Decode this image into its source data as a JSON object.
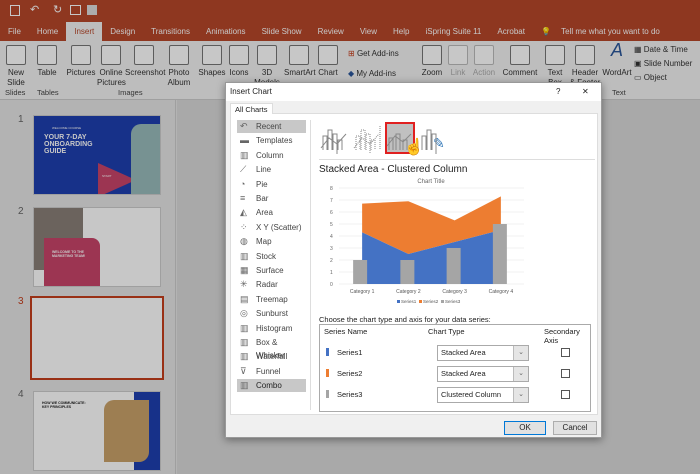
{
  "qat": {
    "icons": [
      "save-icon",
      "undo-icon",
      "redo-icon",
      "present-icon",
      "customize-icon"
    ]
  },
  "tabs": [
    "File",
    "Home",
    "Insert",
    "Design",
    "Transitions",
    "Animations",
    "Slide Show",
    "Review",
    "View",
    "Help",
    "iSpring Suite 11",
    "Acrobat"
  ],
  "active_tab": "Insert",
  "tell_me": "Tell me what you want to do",
  "ribbon": {
    "new_slide": "New Slide",
    "table": "Table",
    "pictures": "Pictures",
    "online_pictures": "Online Pictures",
    "screenshot": "Screenshot",
    "photo_album": "Photo Album",
    "shapes": "Shapes",
    "icons": "Icons",
    "3d": "3D Models",
    "smartart": "SmartArt",
    "chart": "Chart",
    "get_addins": "Get Add-ins",
    "my_addins": "My Add-ins",
    "zoom": "Zoom",
    "link": "Link",
    "action": "Action",
    "comment": "Comment",
    "text_box": "Text Box",
    "header_footer": "Header & Footer",
    "wordart": "WordArt",
    "date_time": "Date & Time",
    "slide_number": "Slide Number",
    "object": "Object",
    "groups": {
      "slides": "Slides",
      "tables": "Tables",
      "images": "Images",
      "text": "Text"
    }
  },
  "slides": [
    {
      "num": "1",
      "eyebrow": "WELCOME COURSE",
      "title": "YOUR 7-DAY ONBOARDING GUIDE",
      "cta": "START"
    },
    {
      "num": "2",
      "title": "WELCOME TO THE MARKETING TEAM!"
    },
    {
      "num": "3"
    },
    {
      "num": "4",
      "title": "HOW WE COMMUNICATE: KEY PRINCIPLES"
    }
  ],
  "dialog": {
    "title": "Insert Chart",
    "help": "?",
    "close": "✕",
    "tab": "All Charts",
    "categories": [
      "Recent",
      "Templates",
      "Column",
      "Line",
      "Pie",
      "Bar",
      "Area",
      "X Y (Scatter)",
      "Map",
      "Stock",
      "Surface",
      "Radar",
      "Treemap",
      "Sunburst",
      "Histogram",
      "Box & Whisker",
      "Waterfall",
      "Funnel",
      "Combo"
    ],
    "category_icons": [
      "↶",
      "▬",
      "▥",
      "⟋",
      "◔",
      "≡",
      "◭",
      "⁘",
      "◍",
      "▥",
      "▦",
      "✳",
      "▤",
      "◎",
      "▥",
      "▥",
      "▥",
      "⊽",
      "▥"
    ],
    "selected_category": "Combo",
    "selected_subtype": "Stacked Area - Clustered Column",
    "heading": "Stacked Area - Clustered Column",
    "series_prompt": "Choose the chart type and axis for your data series:",
    "columns": {
      "name": "Series Name",
      "type": "Chart Type",
      "axis": "Secondary Axis"
    },
    "series_rows": [
      {
        "name": "Series1",
        "type": "Stacked Area",
        "secondary": false,
        "color": "#4472c4"
      },
      {
        "name": "Series2",
        "type": "Stacked Area",
        "secondary": false,
        "color": "#ed7d31"
      },
      {
        "name": "Series3",
        "type": "Clustered Column",
        "secondary": false,
        "color": "#a5a5a5"
      }
    ],
    "ok": "OK",
    "cancel": "Cancel"
  },
  "chart_data": {
    "type": "combo",
    "title": "Chart Title",
    "categories": [
      "Category 1",
      "Category 2",
      "Category 3",
      "Category 4"
    ],
    "series": [
      {
        "name": "Series1",
        "kind": "stacked-area",
        "color": "#4472c4",
        "values": [
          4.3,
          2.5,
          3.5,
          4.5
        ]
      },
      {
        "name": "Series2",
        "kind": "stacked-area",
        "color": "#ed7d31",
        "values": [
          2.4,
          4.4,
          1.8,
          2.8
        ]
      },
      {
        "name": "Series3",
        "kind": "clustered-column",
        "color": "#a5a5a5",
        "values": [
          2,
          2,
          3,
          5
        ]
      }
    ],
    "ylim": [
      0,
      8
    ],
    "yticks": [
      "0",
      "1",
      "2",
      "3",
      "4",
      "5",
      "6",
      "7",
      "8"
    ],
    "grid": true,
    "legend": "bottom"
  }
}
